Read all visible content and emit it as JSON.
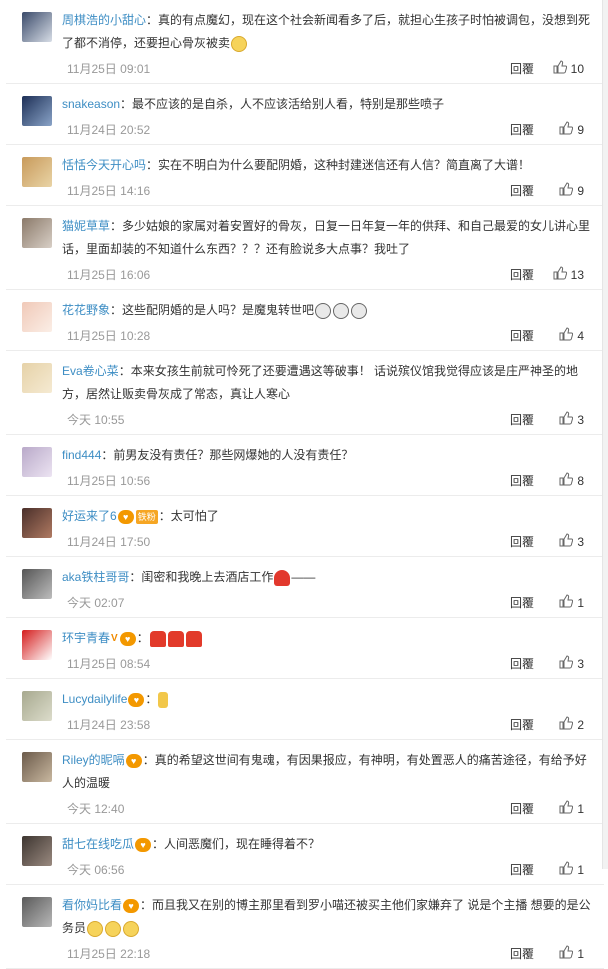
{
  "reply_label": "回覆",
  "colors": {
    "username": "#3e8ec4",
    "meta": "#999999",
    "text": "#333333",
    "badge": "#f39800"
  },
  "comments": [
    {
      "username": "周棋浩的小甜心",
      "text": "：真的有点魔幻，现在这个社会新闻看多了后，就担心生孩子时怕被调包，没想到死了都不消停，还要担心骨灰被卖",
      "badges": [],
      "emoji": [
        "face-icon"
      ],
      "time": "11月25日 09:01",
      "likes": "10",
      "avatar_colors": [
        "#3a4a6a",
        "#d7dde6"
      ]
    },
    {
      "username": "snakeason",
      "text": "：最不应该的是自杀，人不应该活给别人看，特别是那些喷子",
      "badges": [],
      "emoji": [],
      "time": "11月24日 20:52",
      "likes": "9",
      "avatar_colors": [
        "#1d2f56",
        "#8aa4c8"
      ]
    },
    {
      "username": "恬恬今天开心吗",
      "text": "：实在不明白为什么要配阴婚，这种封建迷信还有人信？简直离了大谱！",
      "badges": [],
      "emoji": [],
      "time": "11月25日 14:16",
      "likes": "9",
      "avatar_colors": [
        "#c89a5b",
        "#e9d4a6"
      ]
    },
    {
      "username": "猫妮草草",
      "text": "：多少姑娘的家属对着安置好的骨灰，日复一日年复一年的供拜、和自己最爱的女儿讲心里话，里面却装的不知道什么东西？？？还有脸说多大点事？我吐了",
      "badges": [],
      "emoji": [],
      "time": "11月25日 16:06",
      "likes": "13",
      "avatar_colors": [
        "#8b7a6a",
        "#d8cfc6"
      ]
    },
    {
      "username": "花花野象",
      "text": "：这些配阴婚的是人吗？是魔鬼转世吧",
      "badges": [],
      "emoji": [
        "scared-face-icon",
        "scared-face-icon",
        "scared-face-icon"
      ],
      "time": "11月25日 10:28",
      "likes": "4",
      "avatar_colors": [
        "#f0c9b8",
        "#fbeee6"
      ]
    },
    {
      "username": "Eva卷心菜",
      "text": "：本来女孩生前就可怜死了还要遭遇这等破事！  话说殡仪馆我觉得应该是庄严神圣的地方，居然让贩卖骨灰成了常态，真让人寒心",
      "badges": [],
      "emoji": [],
      "time": "今天 10:55",
      "likes": "3",
      "avatar_colors": [
        "#e6d2a8",
        "#f5ead2"
      ]
    },
    {
      "username": "find444",
      "text": "：前男友没有责任？那些网爆她的人没有责任？",
      "badges": [],
      "emoji": [],
      "time": "11月25日 10:56",
      "likes": "8",
      "avatar_colors": [
        "#b9a9c9",
        "#ece4f2"
      ]
    },
    {
      "username": "好运来了6",
      "text": "：太可怕了",
      "badges": [
        "heart-badge-icon",
        "fan-badge-icon"
      ],
      "badge_text": "铁粉",
      "emoji": [],
      "time": "11月24日 17:50",
      "likes": "3",
      "avatar_colors": [
        "#4a2f2a",
        "#b07a62"
      ]
    },
    {
      "username": "aka铁柱哥哥",
      "text": "：闺密和我晚上去酒店工作",
      "badges": [],
      "emoji": [
        "red-heart-icon"
      ],
      "tail": "——",
      "time": "今天 02:07",
      "likes": "1",
      "avatar_colors": [
        "#555555",
        "#bdbdbd"
      ]
    },
    {
      "username": "环宇青春",
      "text": "：",
      "badges": [
        "vip-badge-icon",
        "heart-badge-icon"
      ],
      "emoji": [
        "candle-icon",
        "candle-icon",
        "candle-icon"
      ],
      "time": "11月25日 08:54",
      "likes": "3",
      "avatar_colors": [
        "#d41c1c",
        "#ffffff"
      ]
    },
    {
      "username": "Lucydailylife",
      "text": "：",
      "badges": [
        "heart-badge-icon"
      ],
      "emoji": [
        "tea-icon"
      ],
      "time": "11月24日 23:58",
      "likes": "2",
      "avatar_colors": [
        "#a7a98f",
        "#dcdccb"
      ]
    },
    {
      "username": "Riley的昵嗝",
      "text": "：真的希望这世间有鬼魂，有因果报应，有神明，有处置恶人的痛苦途径，有给予好人的温暖",
      "badges": [
        "heart-badge-icon"
      ],
      "emoji": [],
      "time": "今天 12:40",
      "likes": "1",
      "avatar_colors": [
        "#6b5a4a",
        "#c9b8a0"
      ]
    },
    {
      "username": "甜七在线吃瓜",
      "text": "：人间恶魔们，现在睡得着不？",
      "badges": [
        "heart-badge-icon"
      ],
      "emoji": [],
      "time": "今天 06:56",
      "likes": "1",
      "avatar_colors": [
        "#3d3530",
        "#9a8a80"
      ]
    },
    {
      "username": "看你妈比看",
      "text": "：而且我又在别的博主那里看到罗小喵还被买主他们家嫌弃了 说是个主播 想要的是公务员",
      "badges": [
        "heart-badge-icon"
      ],
      "emoji": [
        "face-icon",
        "face-icon",
        "face-icon"
      ],
      "time": "11月25日 22:18",
      "likes": "1",
      "avatar_colors": [
        "#5a5a5a",
        "#b8b8b8"
      ]
    }
  ]
}
